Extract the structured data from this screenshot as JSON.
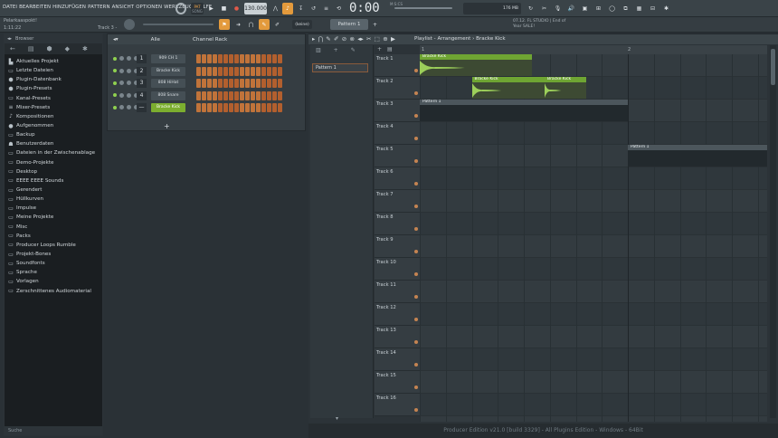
{
  "menu": [
    "DATEI",
    "BEARBEITEN",
    "HINZUFÜGEN",
    "PATTERN",
    "ANSICHT",
    "OPTIONEN",
    "WERKZEUGE",
    "HILFE"
  ],
  "transport": {
    "tempo": "130.000",
    "time": "0:00",
    "time_units": "M:S:CS",
    "pat_label": "PAT",
    "song_label": "SONG"
  },
  "project": {
    "name": "Pelarkaaspokt!",
    "position": "1:11:22",
    "track_hint": "Track 3 -"
  },
  "toolbar2": {
    "snap": "(keine)",
    "pattern_selector": "Pattern 1",
    "news": "07.12. FL STUDIO | End of Year SALE!",
    "cpu": "176 MB",
    "voices": "0"
  },
  "browser": {
    "title": "Browser",
    "items": [
      {
        "label": "Aktuelles Projekt",
        "icon": "project-icon"
      },
      {
        "label": "Letzte Dateien",
        "icon": "folder-icon"
      },
      {
        "label": "Plugin-Datenbank",
        "icon": "plugin-icon"
      },
      {
        "label": "Plugin-Presets",
        "icon": "plugin-icon"
      },
      {
        "label": "Kanal-Presets",
        "icon": "folder-icon"
      },
      {
        "label": "Mixer-Presets",
        "icon": "mixer-icon"
      },
      {
        "label": "Kompositionen",
        "icon": "note-icon"
      },
      {
        "label": "Aufgenommen",
        "icon": "mic-icon"
      },
      {
        "label": "Backup",
        "icon": "folder-icon"
      },
      {
        "label": "Benutzerdaten",
        "icon": "user-icon"
      },
      {
        "label": "Dateien in der Zwischenablage",
        "icon": "folder-icon"
      },
      {
        "label": "Demo-Projekte",
        "icon": "folder-icon"
      },
      {
        "label": "Desktop",
        "icon": "folder-icon"
      },
      {
        "label": "EEEE EEEE Sounds",
        "icon": "folder-icon"
      },
      {
        "label": "Gerendert",
        "icon": "folder-icon"
      },
      {
        "label": "Hüllkurven",
        "icon": "folder-icon"
      },
      {
        "label": "Impulse",
        "icon": "folder-icon"
      },
      {
        "label": "Meine Projekte",
        "icon": "folder-icon"
      },
      {
        "label": "Misc",
        "icon": "folder-icon"
      },
      {
        "label": "Packs",
        "icon": "folder-icon"
      },
      {
        "label": "Producer Loops Rumble",
        "icon": "folder-icon"
      },
      {
        "label": "Projekt-Bones",
        "icon": "folder-icon"
      },
      {
        "label": "Soundfonts",
        "icon": "folder-icon"
      },
      {
        "label": "Sprache",
        "icon": "folder-icon"
      },
      {
        "label": "Vorlagen",
        "icon": "folder-icon"
      },
      {
        "label": "Zerschnittenes Audiomaterial",
        "icon": "folder-icon"
      }
    ],
    "search_placeholder": "Suche"
  },
  "rack": {
    "title": "Channel Rack",
    "filter": "Alle",
    "channels": [
      {
        "num": "1",
        "name": "909 CH 1",
        "lit": []
      },
      {
        "num": "2",
        "name": "Bracke Kick",
        "lit": []
      },
      {
        "num": "3",
        "name": "808 HiHat",
        "lit": []
      },
      {
        "num": "4",
        "name": "808 Snare",
        "lit": []
      },
      {
        "num": "—",
        "name": "Bracke Kick",
        "lit": [],
        "selected": true
      }
    ],
    "add_label": "+"
  },
  "playlist": {
    "title": "Playlist - Arrangement › Bracke Kick",
    "pattern": "Pattern 1",
    "ruler": [
      "1",
      "2"
    ],
    "tracks": [
      "Track 1",
      "Track 2",
      "Track 3",
      "Track 4",
      "Track 5",
      "Track 6",
      "Track 7",
      "Track 8",
      "Track 9",
      "Track 10",
      "Track 11",
      "Track 12",
      "Track 13",
      "Track 14",
      "Track 15",
      "Track 16"
    ],
    "clips": [
      {
        "track": 0,
        "label": "Bracke Kick",
        "start": 0,
        "len": 0.54
      },
      {
        "track": 1,
        "label": "Bracke Kick",
        "start": 0.25,
        "len": 0.35
      },
      {
        "track": 1,
        "label": "Bracke Kick",
        "start": 0.6,
        "len": 0.2
      }
    ],
    "pattern_clips": [
      {
        "track": 2,
        "label": "Pattern 1",
        "start": 0,
        "len": 1.0
      },
      {
        "track": 4,
        "label": "Pattern 1",
        "start": 1.0,
        "len": 0.7
      }
    ]
  },
  "status": "Producer Edition v21.0 [build 3329] - All Plugins Edition - Windows - 64Bit"
}
